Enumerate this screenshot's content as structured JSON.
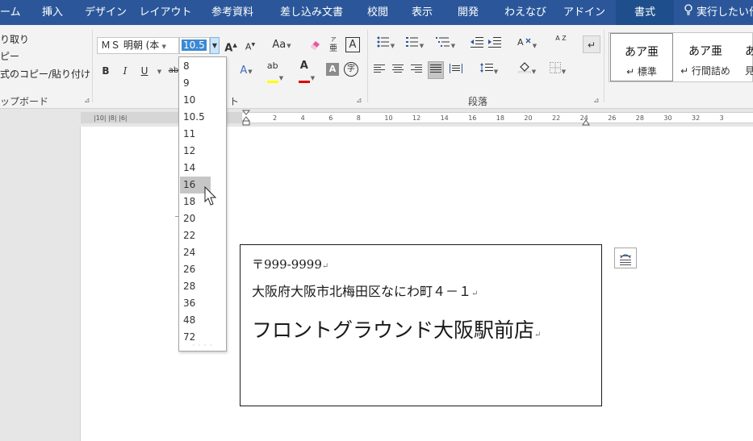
{
  "tabs": [
    {
      "label": "ーム"
    },
    {
      "label": "挿入"
    },
    {
      "label": "デザイン"
    },
    {
      "label": "レイアウト"
    },
    {
      "label": "参考資料"
    },
    {
      "label": "差し込み文書"
    },
    {
      "label": "校閲"
    },
    {
      "label": "表示"
    },
    {
      "label": "開発"
    },
    {
      "label": "わえなび"
    },
    {
      "label": "アドイン"
    },
    {
      "label": "書式"
    },
    {
      "label": "実行したい作"
    }
  ],
  "clipboard": {
    "cut": "り取り",
    "copy": "ピー",
    "format_painter": "式のコピー/貼り付け",
    "group_label": "ップボード"
  },
  "font": {
    "name": "ＭＳ 明朝 (本",
    "size": "10.5",
    "grow_label": "A",
    "shrink_label": "A",
    "case_label": "Aa",
    "ruby_label": "亜",
    "border_char_label": "A",
    "bold": "B",
    "italic": "I",
    "underline": "U",
    "strike_fragment": "ab",
    "effects_label": "A",
    "highlight_label": "ab",
    "color_label": "A",
    "shading_label": "A",
    "enclose_label": "字",
    "group_label": "ト"
  },
  "paragraph": {
    "sort_label": "A Z",
    "group_label": "段落"
  },
  "styles": [
    {
      "sample": "あア亜",
      "name": "↵ 標準"
    },
    {
      "sample": "あア亜",
      "name": "↵ 行間詰め"
    },
    {
      "sample": "あ",
      "name": "見"
    }
  ],
  "font_size_options": [
    "8",
    "9",
    "10",
    "10.5",
    "11",
    "12",
    "14",
    "16",
    "18",
    "20",
    "22",
    "24",
    "26",
    "28",
    "36",
    "48",
    "72"
  ],
  "font_size_highlighted": "16",
  "ruler": {
    "left_numbers": "|10| |8| |6|",
    "numbers": [
      "2",
      "4",
      "6",
      "8",
      "10",
      "12",
      "14",
      "16",
      "18",
      "20",
      "22",
      "24",
      "26",
      "28",
      "30",
      "32",
      "3"
    ]
  },
  "textbox": {
    "line1": "〒999-9999",
    "line2": "大阪府大阪市北梅田区なにわ町４－１",
    "line3": "フロントグラウンド大阪駅前店",
    "paragraph_mark": "↵"
  },
  "colors": {
    "tab_bar": "#2b579a",
    "highlight_yellow": "#ffff00",
    "font_red": "#e00000",
    "selection_blue": "#3b88d3"
  }
}
